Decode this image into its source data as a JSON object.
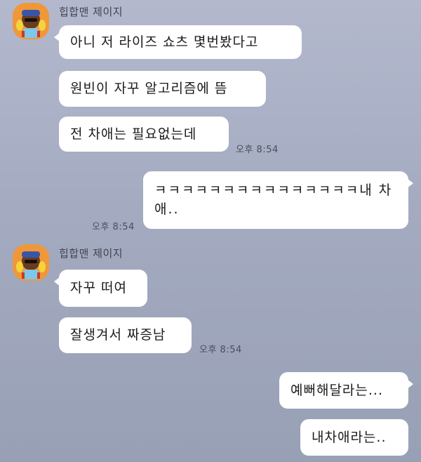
{
  "sender_name": "힙합맨 제이지",
  "messages": {
    "m1": "아니 저 라이즈 쇼츠 몇번봤다고",
    "m2": "원빈이 자꾸 알고리즘에 뜸",
    "m3": "전 차애는 필요없는데",
    "m4": "ㅋㅋㅋㅋㅋㅋㅋㅋㅋㅋㅋㅋㅋㅋㅋ내 차애..",
    "m5": "자꾸 떠여",
    "m6": "잘생겨서 짜증남",
    "m7": "예뻐해달라는...",
    "m8": "내차애라는.."
  },
  "times": {
    "t1": "오후 8:54",
    "t2": "오후 8:54",
    "t3": "오후 8:54"
  },
  "colors": {
    "bubble": "#ffffff",
    "avatar_bg": "#f0973a",
    "background_top": "#b3b8cd",
    "background_bottom": "#98a0b6"
  },
  "icons": {
    "avatar": "character-avatar-icon"
  }
}
